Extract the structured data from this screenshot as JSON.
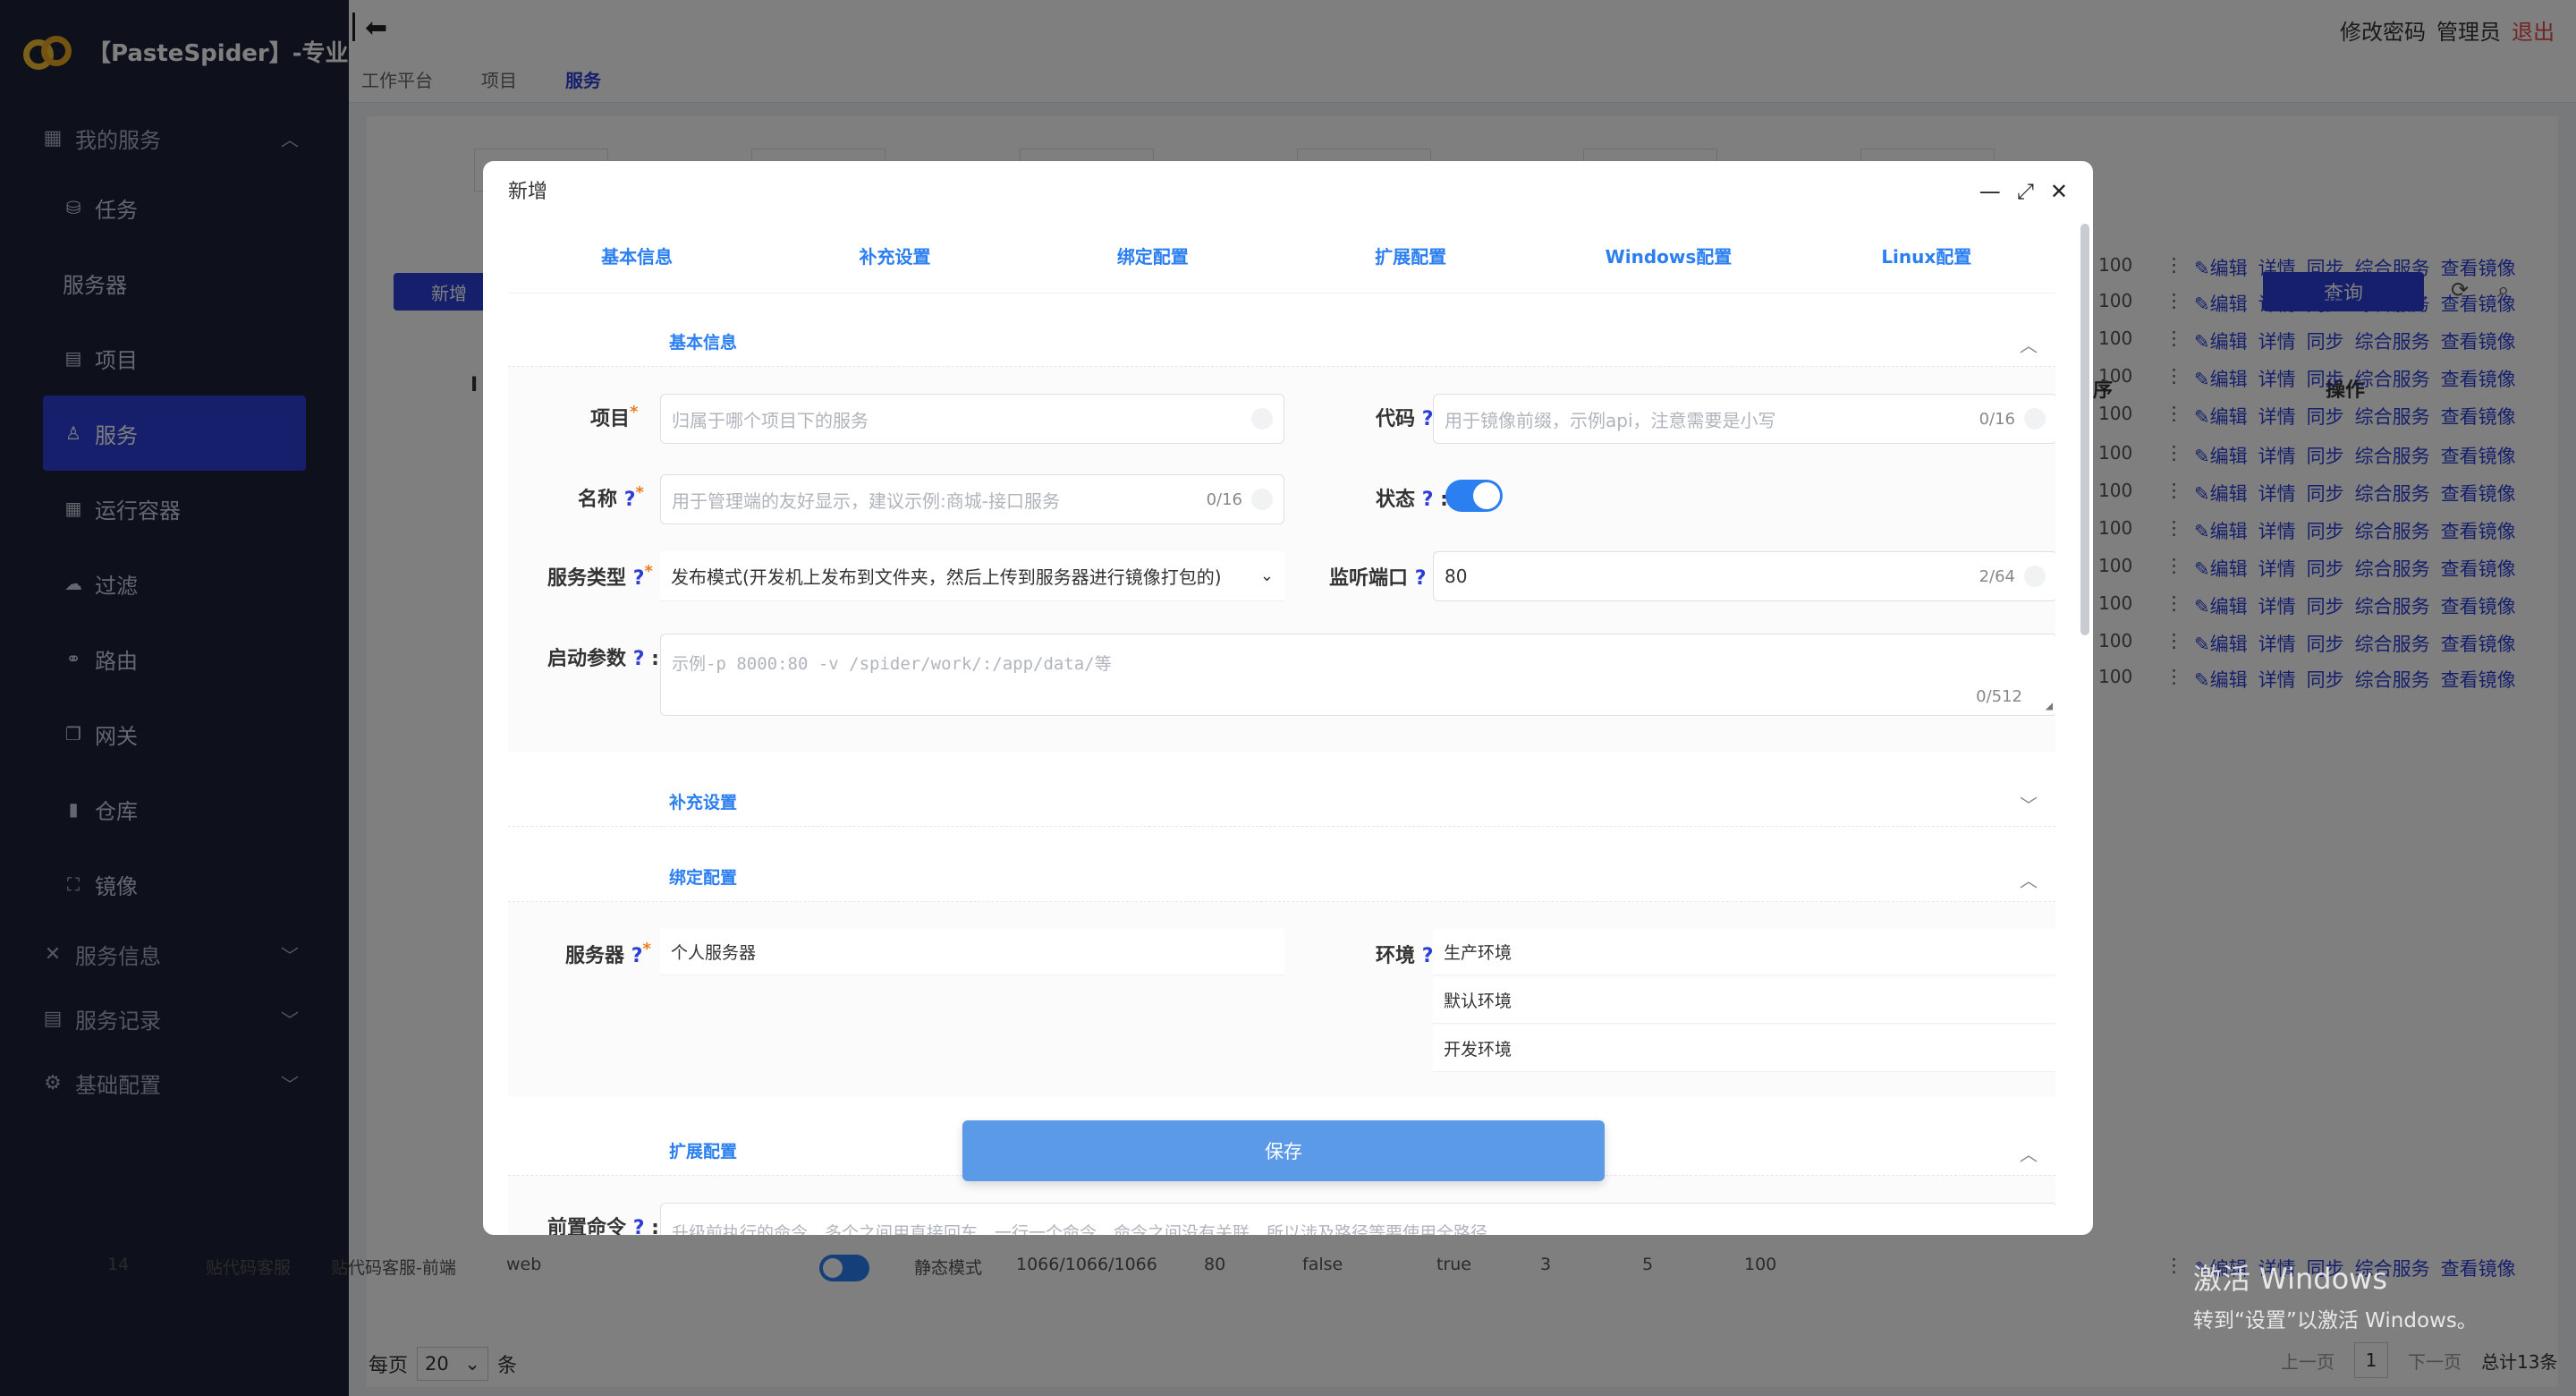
{
  "brand": {
    "title": "【PasteSpider】-专业版"
  },
  "sidebar": {
    "groups": [
      {
        "label": "我的服务",
        "icon": "grid-icon"
      },
      {
        "label": "服务信息",
        "icon": "tools-icon"
      },
      {
        "label": "服务记录",
        "icon": "doc-icon"
      },
      {
        "label": "基础配置",
        "icon": "gear-icon"
      }
    ],
    "items": [
      {
        "label": "任务",
        "icon": "database-icon"
      },
      {
        "label": "服务器",
        "icon": ""
      },
      {
        "label": "项目",
        "icon": "table-icon"
      },
      {
        "label": "服务",
        "icon": "user-icon"
      },
      {
        "label": "运行容器",
        "icon": "grid-icon"
      },
      {
        "label": "过滤",
        "icon": "cloud-icon"
      },
      {
        "label": "路由",
        "icon": "link-icon"
      },
      {
        "label": "网关",
        "icon": "window-icon"
      },
      {
        "label": "仓库",
        "icon": "book-icon"
      },
      {
        "label": "镜像",
        "icon": "bag-icon"
      }
    ]
  },
  "header": {
    "breadcrumbs": [
      "工作平台",
      "项目",
      "服务"
    ],
    "change_password": "修改密码",
    "user": "管理员",
    "logout": "退出"
  },
  "list": {
    "new_button": "新增",
    "query_button": "查询",
    "col_id": "I",
    "col_seq": "序",
    "col_ops": "操作",
    "row_value": "100",
    "ops": [
      "编辑",
      "详情",
      "同步",
      "综合服务",
      "查看镜像"
    ],
    "row14": {
      "id": "14",
      "name": "贴代码客服",
      "code": "贴代码客服-前端",
      "type": "web",
      "mode": "静态模式",
      "nums": "1066/1066/1066",
      "port": "80",
      "b1": "false",
      "b2": "true",
      "n1": "3",
      "n2": "5",
      "n3": "100"
    },
    "pager": {
      "per_page_label": "每页",
      "per_page": "20",
      "per_page_suffix": "条",
      "prev": "上一页",
      "page": "1",
      "next": "下一页",
      "total": "总计13条"
    }
  },
  "watermark": {
    "line1": "激活 Windows",
    "line2": "转到“设置”以激活 Windows。"
  },
  "modal": {
    "title": "新增",
    "tabs": [
      "基本信息",
      "补充设置",
      "绑定配置",
      "扩展配置",
      "Windows配置",
      "Linux配置"
    ],
    "sections": {
      "basic": "基本信息",
      "extra": "补充设置",
      "bind": "绑定配置",
      "ext": "扩展配置"
    },
    "fields": {
      "project_label": "项目",
      "project_placeholder": "归属于哪个项目下的服务",
      "code_label": "代码",
      "code_placeholder": "用于镜像前缀，示例api，注意需要是小写",
      "code_count": "0/16",
      "name_label": "名称",
      "name_placeholder": "用于管理端的友好显示，建议示例:商城-接口服务",
      "name_count": "0/16",
      "status_label": "状态",
      "status_on": true,
      "type_label": "服务类型",
      "type_value": "发布模式(开发机上发布到文件夹，然后上传到服务器进行镜像打包的)",
      "port_label": "监听端口",
      "port_value": "80",
      "port_count": "2/64",
      "args_label": "启动参数",
      "args_placeholder": "示例-p 8000:80 -v /spider/work/:/app/data/等",
      "args_count": "0/512",
      "server_label": "服务器",
      "server_value": "个人服务器",
      "env_label": "环境",
      "env_options": [
        "生产环境",
        "默认环境",
        "开发环境"
      ],
      "precmd_label": "前置命令",
      "precmd_placeholder": "升级前执行的命令，多个之间用直接回车，一行一个命令，命令之间没有关联，所以涉及路径等要使用全路径"
    },
    "save_button": "保存"
  }
}
